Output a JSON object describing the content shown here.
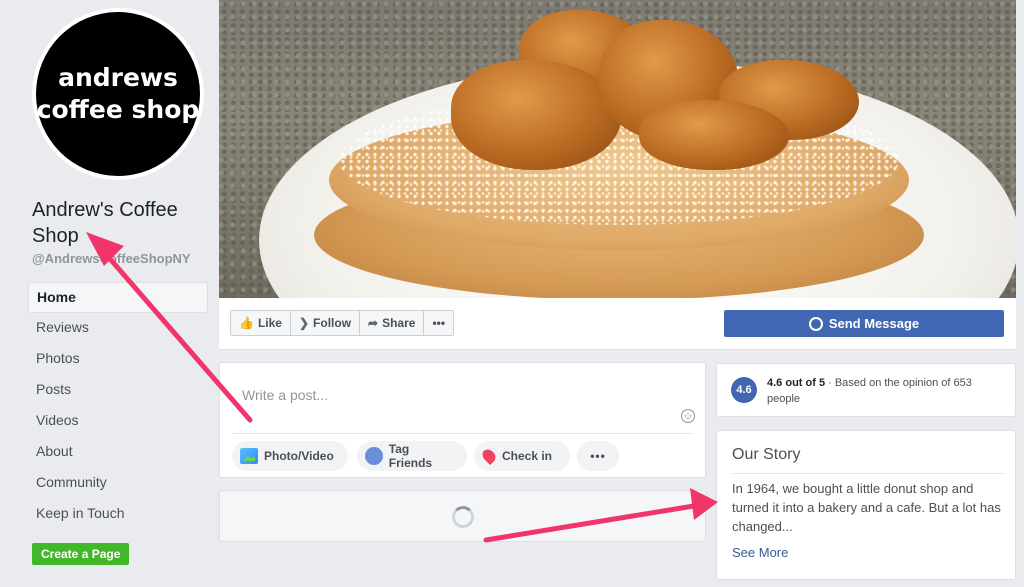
{
  "profile": {
    "logo_line1": "andrews",
    "logo_line2": "coffee shop",
    "name": "Andrew's Coffee Shop",
    "handle": "@AndrewsCoffeeShopNY"
  },
  "nav": {
    "items": [
      {
        "label": "Home",
        "active": true
      },
      {
        "label": "Reviews"
      },
      {
        "label": "Photos"
      },
      {
        "label": "Posts"
      },
      {
        "label": "Videos"
      },
      {
        "label": "About"
      },
      {
        "label": "Community"
      },
      {
        "label": "Keep in Touch"
      }
    ],
    "create_page": "Create a Page"
  },
  "actions": {
    "like": "Like",
    "follow": "Follow",
    "share": "Share",
    "more": "•••",
    "send_message": "Send Message"
  },
  "composer": {
    "placeholder": "Write a post...",
    "photo_video": "Photo/Video",
    "tag_friends": "Tag Friends",
    "check_in": "Check in",
    "more": "•••"
  },
  "rating": {
    "badge": "4.6",
    "score_text": "4.6 out of 5",
    "rest_text": " · Based on the opinion of 653 people"
  },
  "story": {
    "title": "Our Story",
    "body": "In 1964, we bought a little donut shop and turned it into a bakery and a cafe. But a lot has changed...",
    "see_more": "See More"
  },
  "colors": {
    "brand_blue": "#4267b2",
    "create_green": "#42b72a",
    "annotation_arrow": "#f0356b",
    "background": "#e9ebee"
  }
}
